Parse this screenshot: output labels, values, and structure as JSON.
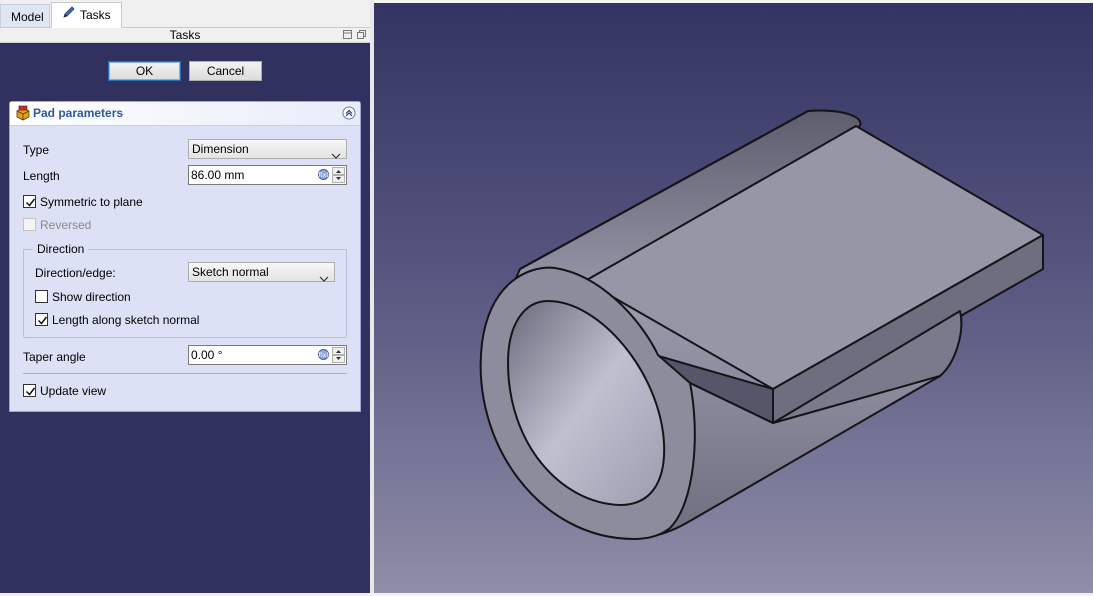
{
  "tabs": [
    {
      "label": "Model",
      "active": false
    },
    {
      "label": "Tasks",
      "active": true
    }
  ],
  "panel_title": "Tasks",
  "buttons": {
    "ok": "OK",
    "cancel": "Cancel"
  },
  "pad": {
    "title": "Pad parameters",
    "type_label": "Type",
    "type_value": "Dimension",
    "length_label": "Length",
    "length_value": "86.00 mm",
    "symmetric_label": "Symmetric to plane",
    "symmetric_checked": true,
    "reversed_label": "Reversed",
    "reversed_checked": false,
    "reversed_enabled": false,
    "direction": {
      "legend": "Direction",
      "edge_label": "Direction/edge:",
      "edge_value": "Sketch normal",
      "show_direction_label": "Show direction",
      "show_direction_checked": false,
      "along_normal_label": "Length along sketch normal",
      "along_normal_checked": true
    },
    "taper_label": "Taper angle",
    "taper_value": "0.00 °",
    "update_view_label": "Update view",
    "update_view_checked": true
  },
  "icons": [
    "sketch-pencil-icon",
    "dock-float-icon",
    "dock-close-icon",
    "pad-feature-icon",
    "collapse-icon",
    "expression-icon",
    "chevron-down-icon"
  ],
  "colors": {
    "panel_bg": "#313160",
    "box_bg": "#dde1f5",
    "title_text": "#2b58a6",
    "viewport_top": "#343463",
    "viewport_bottom": "#8e8ea8",
    "model_face": "#8a8a98"
  }
}
